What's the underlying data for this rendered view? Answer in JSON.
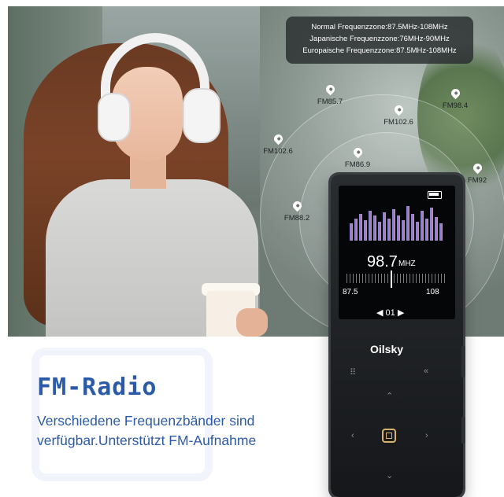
{
  "frequency_zones": [
    "Normal Frequenzzone:87.5MHz-108MHz",
    "Japanische Frequenzzone:76MHz-90MHz",
    "Europaische Frequenzzone:87.5MHz-108MHz"
  ],
  "stations": [
    "FM85.7",
    "FM98.4",
    "FM102.6",
    "FM102.6",
    "FM86.9",
    "FM92",
    "FM88.2"
  ],
  "player": {
    "frequency": "98.7",
    "unit": "MHZ",
    "range_low": "87.5",
    "range_high": "108",
    "preset": "01",
    "brand": "Oilsky"
  },
  "headline": "FM-Radio",
  "description": "Verschiedene Frequenzbänder sind verfügbar.Unterstützt FM-Aufnahme"
}
